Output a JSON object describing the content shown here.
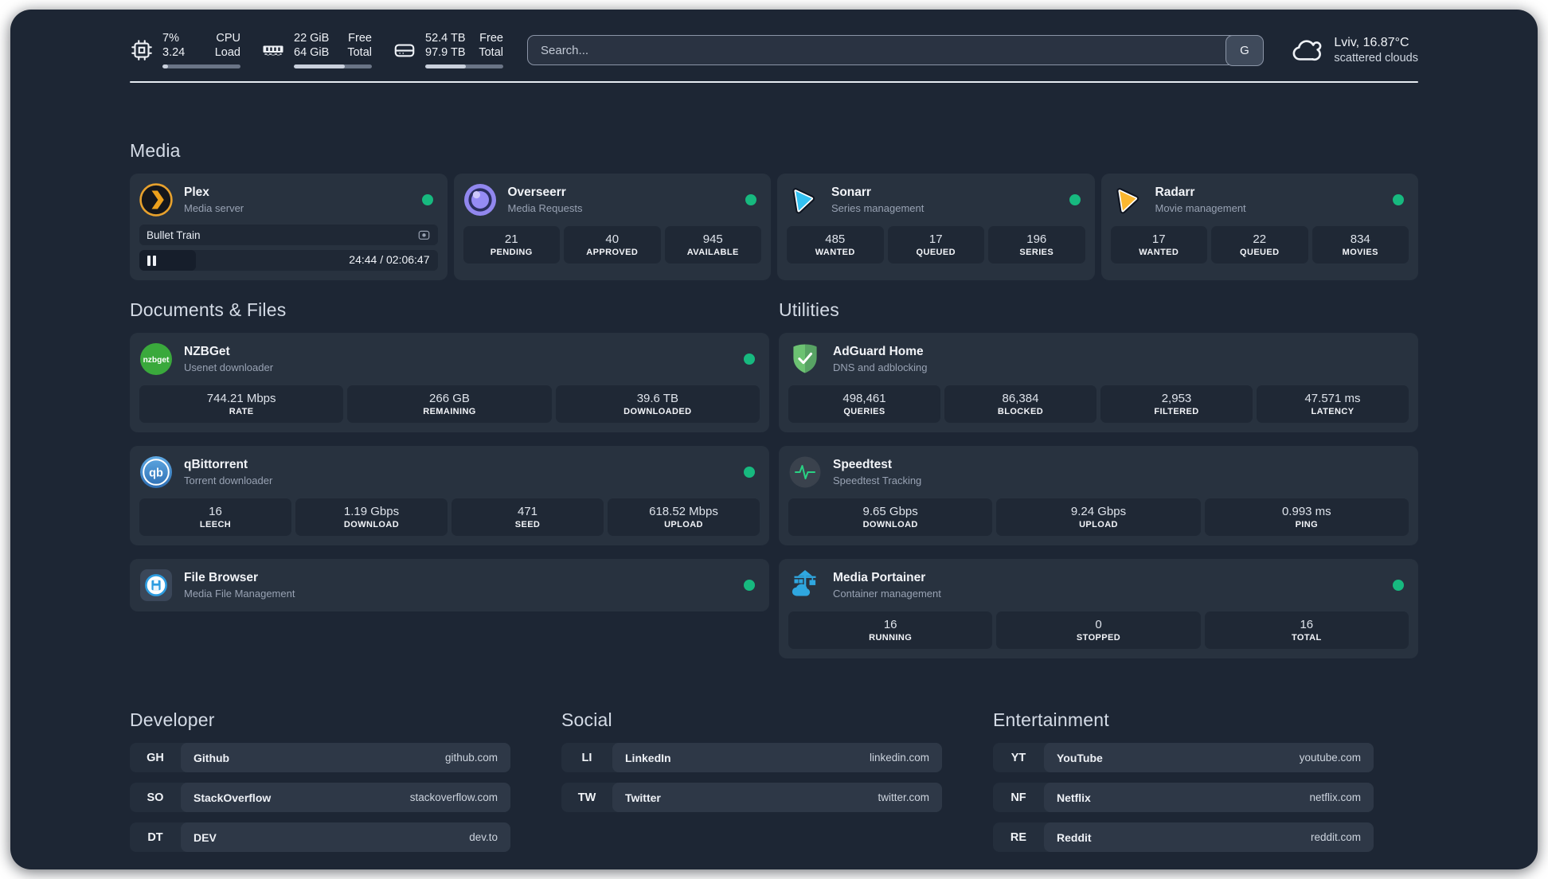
{
  "topbar": {
    "stats": [
      {
        "icon": "cpu-icon",
        "value_top": "7%",
        "value_bottom": "3.24",
        "label_top": "CPU",
        "label_bottom": "Load",
        "progress_pct": 7
      },
      {
        "icon": "ram-icon",
        "value_top": "22 GiB",
        "value_bottom": "64 GiB",
        "label_top": "Free",
        "label_bottom": "Total",
        "progress_pct": 65
      },
      {
        "icon": "disk-icon",
        "value_top": "52.4 TB",
        "value_bottom": "97.9 TB",
        "label_top": "Free",
        "label_bottom": "Total",
        "progress_pct": 52
      }
    ],
    "search": {
      "placeholder": "Search...",
      "provider_button": "G"
    },
    "weather": {
      "icon": "cloud-icon",
      "title": "Lviv, 16.87°C",
      "subtitle": "scattered clouds"
    }
  },
  "app_sections": [
    {
      "title": "Media",
      "apps": [
        {
          "icon": "plex-icon",
          "name": "Plex",
          "desc": "Media server",
          "online": true,
          "player": {
            "title": "Bullet Train",
            "time": "24:44 / 02:06:47",
            "progress_pct": 19
          }
        },
        {
          "icon": "overseerr-icon",
          "name": "Overseerr",
          "desc": "Media Requests",
          "online": true,
          "stats": [
            {
              "value": "21",
              "label": "PENDING"
            },
            {
              "value": "40",
              "label": "APPROVED"
            },
            {
              "value": "945",
              "label": "AVAILABLE"
            }
          ]
        },
        {
          "icon": "sonarr-icon",
          "name": "Sonarr",
          "desc": "Series management",
          "online": true,
          "stats": [
            {
              "value": "485",
              "label": "WANTED"
            },
            {
              "value": "17",
              "label": "QUEUED"
            },
            {
              "value": "196",
              "label": "SERIES"
            }
          ]
        },
        {
          "icon": "radarr-icon",
          "name": "Radarr",
          "desc": "Movie management",
          "online": true,
          "stats": [
            {
              "value": "17",
              "label": "WANTED"
            },
            {
              "value": "22",
              "label": "QUEUED"
            },
            {
              "value": "834",
              "label": "MOVIES"
            }
          ]
        }
      ]
    },
    {
      "title": "Documents & Files",
      "apps": [
        {
          "icon": "nzbget-icon",
          "name": "NZBGet",
          "desc": "Usenet downloader",
          "online": true,
          "stats": [
            {
              "value": "744.21 Mbps",
              "label": "RATE"
            },
            {
              "value": "266 GB",
              "label": "REMAINING"
            },
            {
              "value": "39.6 TB",
              "label": "DOWNLOADED"
            }
          ]
        },
        {
          "icon": "qbittorrent-icon",
          "name": "qBittorrent",
          "desc": "Torrent downloader",
          "online": true,
          "stats": [
            {
              "value": "16",
              "label": "LEECH"
            },
            {
              "value": "1.19 Gbps",
              "label": "DOWNLOAD"
            },
            {
              "value": "471",
              "label": "SEED"
            },
            {
              "value": "618.52 Mbps",
              "label": "UPLOAD"
            }
          ]
        },
        {
          "icon": "filebrowser-icon",
          "name": "File Browser",
          "desc": "Media File Management",
          "online": true
        }
      ]
    },
    {
      "title": "Utilities",
      "apps": [
        {
          "icon": "adguard-icon",
          "name": "AdGuard Home",
          "desc": "DNS and adblocking",
          "online": false,
          "stats": [
            {
              "value": "498,461",
              "label": "QUERIES"
            },
            {
              "value": "86,384",
              "label": "BLOCKED"
            },
            {
              "value": "2,953",
              "label": "FILTERED"
            },
            {
              "value": "47.571 ms",
              "label": "LATENCY"
            }
          ]
        },
        {
          "icon": "speedtest-icon",
          "name": "Speedtest",
          "desc": "Speedtest Tracking",
          "online": false,
          "stats": [
            {
              "value": "9.65 Gbps",
              "label": "DOWNLOAD"
            },
            {
              "value": "9.24 Gbps",
              "label": "UPLOAD"
            },
            {
              "value": "0.993 ms",
              "label": "PING"
            }
          ]
        },
        {
          "icon": "portainer-icon",
          "name": "Media Portainer",
          "desc": "Container management",
          "online": true,
          "stats": [
            {
              "value": "16",
              "label": "RUNNING"
            },
            {
              "value": "0",
              "label": "STOPPED"
            },
            {
              "value": "16",
              "label": "TOTAL"
            }
          ]
        }
      ]
    }
  ],
  "bookmarks": [
    {
      "title": "Developer",
      "links": [
        {
          "abbr": "GH",
          "name": "Github",
          "url": "github.com"
        },
        {
          "abbr": "SO",
          "name": "StackOverflow",
          "url": "stackoverflow.com"
        },
        {
          "abbr": "DT",
          "name": "DEV",
          "url": "dev.to"
        }
      ]
    },
    {
      "title": "Social",
      "links": [
        {
          "abbr": "LI",
          "name": "LinkedIn",
          "url": "linkedin.com"
        },
        {
          "abbr": "TW",
          "name": "Twitter",
          "url": "twitter.com"
        }
      ]
    },
    {
      "title": "Entertainment",
      "links": [
        {
          "abbr": "YT",
          "name": "YouTube",
          "url": "youtube.com"
        },
        {
          "abbr": "NF",
          "name": "Netflix",
          "url": "netflix.com"
        },
        {
          "abbr": "RE",
          "name": "Reddit",
          "url": "reddit.com"
        }
      ]
    }
  ],
  "colors": {
    "status_online": "#17b97f",
    "accent_plex": "#e7a12d",
    "panel": "#1d2634"
  }
}
